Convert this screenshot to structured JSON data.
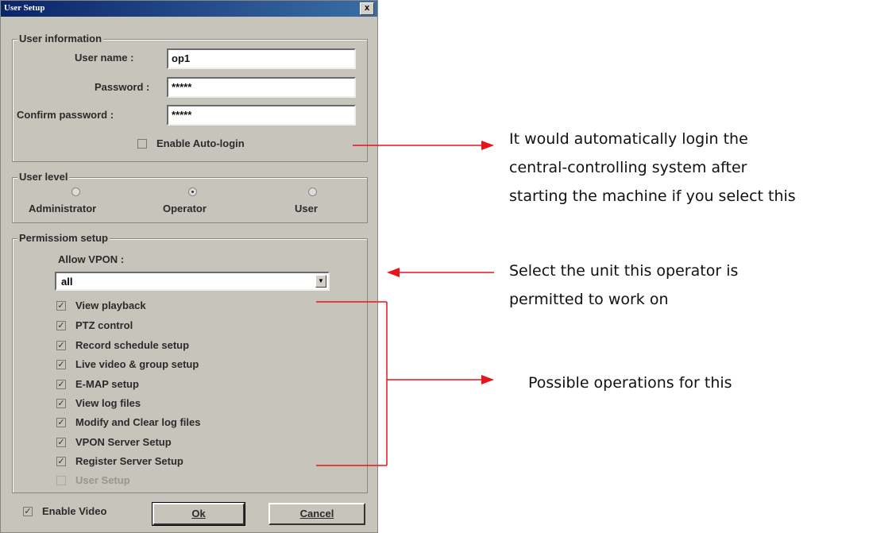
{
  "dialog": {
    "title": "User Setup",
    "close_label": "x",
    "user_info": {
      "legend": "User information",
      "username_label": "User name :",
      "username_value": "op1",
      "password_label": "Password :",
      "password_value": "*****",
      "confirm_label": "Confirm password :",
      "confirm_value": "*****",
      "autologin_label": "Enable Auto-login",
      "autologin_checked": false
    },
    "user_level": {
      "legend": "User level",
      "options": [
        "Administrator",
        "Operator",
        "User"
      ],
      "selected": "Operator"
    },
    "permission": {
      "legend": "Permissiom setup",
      "allow_label": "Allow VPON :",
      "allow_value": "all",
      "items": [
        {
          "label": "View playback",
          "checked": true,
          "enabled": true
        },
        {
          "label": "PTZ control",
          "checked": true,
          "enabled": true
        },
        {
          "label": "Record schedule setup",
          "checked": true,
          "enabled": true
        },
        {
          "label": "Live video & group setup",
          "checked": true,
          "enabled": true
        },
        {
          "label": "E-MAP setup",
          "checked": true,
          "enabled": true
        },
        {
          "label": "View log files",
          "checked": true,
          "enabled": true
        },
        {
          "label": "Modify and Clear log files",
          "checked": true,
          "enabled": true
        },
        {
          "label": "VPON Server Setup",
          "checked": true,
          "enabled": true
        },
        {
          "label": "Register Server Setup",
          "checked": true,
          "enabled": true
        },
        {
          "label": "User Setup",
          "checked": false,
          "enabled": false
        }
      ]
    },
    "enable_video_label": "Enable Video",
    "enable_video_checked": true,
    "ok_label": "Ok",
    "cancel_label": "Cancel"
  },
  "annotations": {
    "autologin_line1": "It would automatically login the",
    "autologin_line2": "central-controlling system after",
    "autologin_line3": "starting the machine if you select this",
    "unit_line1": "Select the unit this operator is",
    "unit_line2": "permitted to work on",
    "ops_line1": "Possible operations for this"
  },
  "colors": {
    "arrow": "#e8141c",
    "titlebar": "#0a246a"
  }
}
